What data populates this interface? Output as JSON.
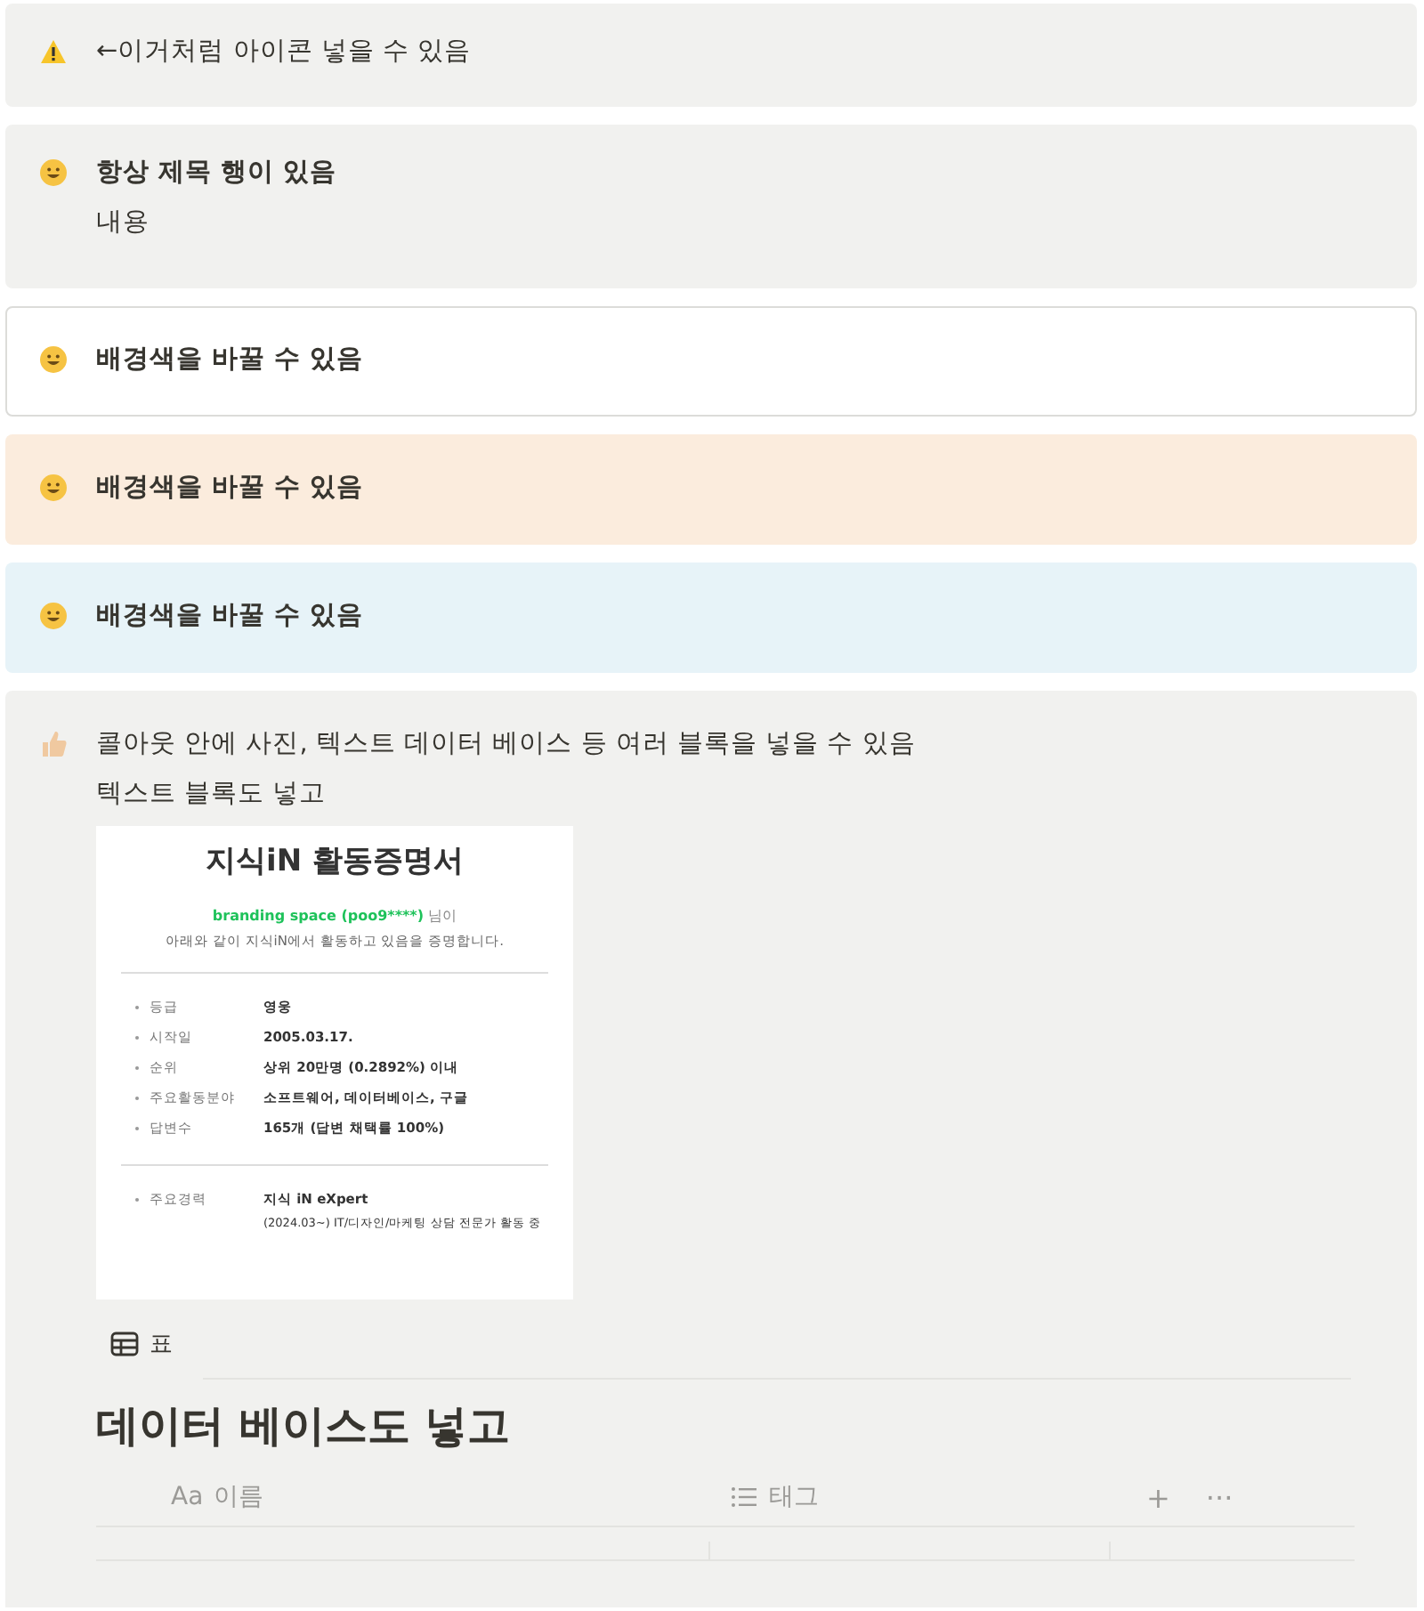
{
  "callouts": [
    {
      "kind": "warning",
      "color": "#f1f1ef",
      "bordered": false,
      "text": "←이거처럼 아이콘 넣을 수 있음"
    },
    {
      "kind": "smiley",
      "color": "#f1f1ef",
      "bordered": false,
      "title": "항상 제목 행이 있음",
      "body": "내용"
    },
    {
      "kind": "smiley",
      "color": "#ffffff",
      "bordered": true,
      "title": "배경색을 바꿀 수 있음"
    },
    {
      "kind": "smiley",
      "color": "#fbecdd",
      "bordered": false,
      "title": "배경색을 바꿀 수 있음"
    },
    {
      "kind": "smiley",
      "color": "#e7f3f8",
      "bordered": false,
      "title": "배경색을 바꿀 수 있음"
    }
  ],
  "big_callout": {
    "kind": "thumbs-up",
    "color": "#f1f1ef",
    "lines": [
      "콜아웃 안에 사진, 텍스트 데이터 베이스 등 여러 블록을 넣을 수 있음",
      "텍스트 블록도 넣고"
    ],
    "certificate": {
      "title": "지식iN 활동증명서",
      "user": "branding space (poo9****)",
      "user_suffix": "님이",
      "subtitle": "아래와 같이 지식iN에서 활동하고 있음을 증명합니다.",
      "rows": [
        {
          "label": "등급",
          "value": "영웅"
        },
        {
          "label": "시작일",
          "value": "2005.03.17."
        },
        {
          "label": "순위",
          "value": "상위 20만명 (0.2892%) 이내"
        },
        {
          "label": "주요활동분야",
          "value": "소프트웨어, 데이터베이스, 구글"
        },
        {
          "label": "답변수",
          "value": "165개 (답변 채택률 100%)"
        }
      ],
      "career_label": "주요경력",
      "career_title": "지식 iN eXpert",
      "career_detail": "(2024.03~) IT/디자인/마케팅 상담 전문가 활동 중"
    },
    "database": {
      "view_tab": "표",
      "title": "데이터 베이스도 넣고",
      "columns": [
        {
          "kind": "text",
          "type_label": "Aa",
          "label": "이름"
        },
        {
          "kind": "list",
          "label": "태그"
        }
      ],
      "add_button": "+",
      "more_button": "···"
    }
  }
}
